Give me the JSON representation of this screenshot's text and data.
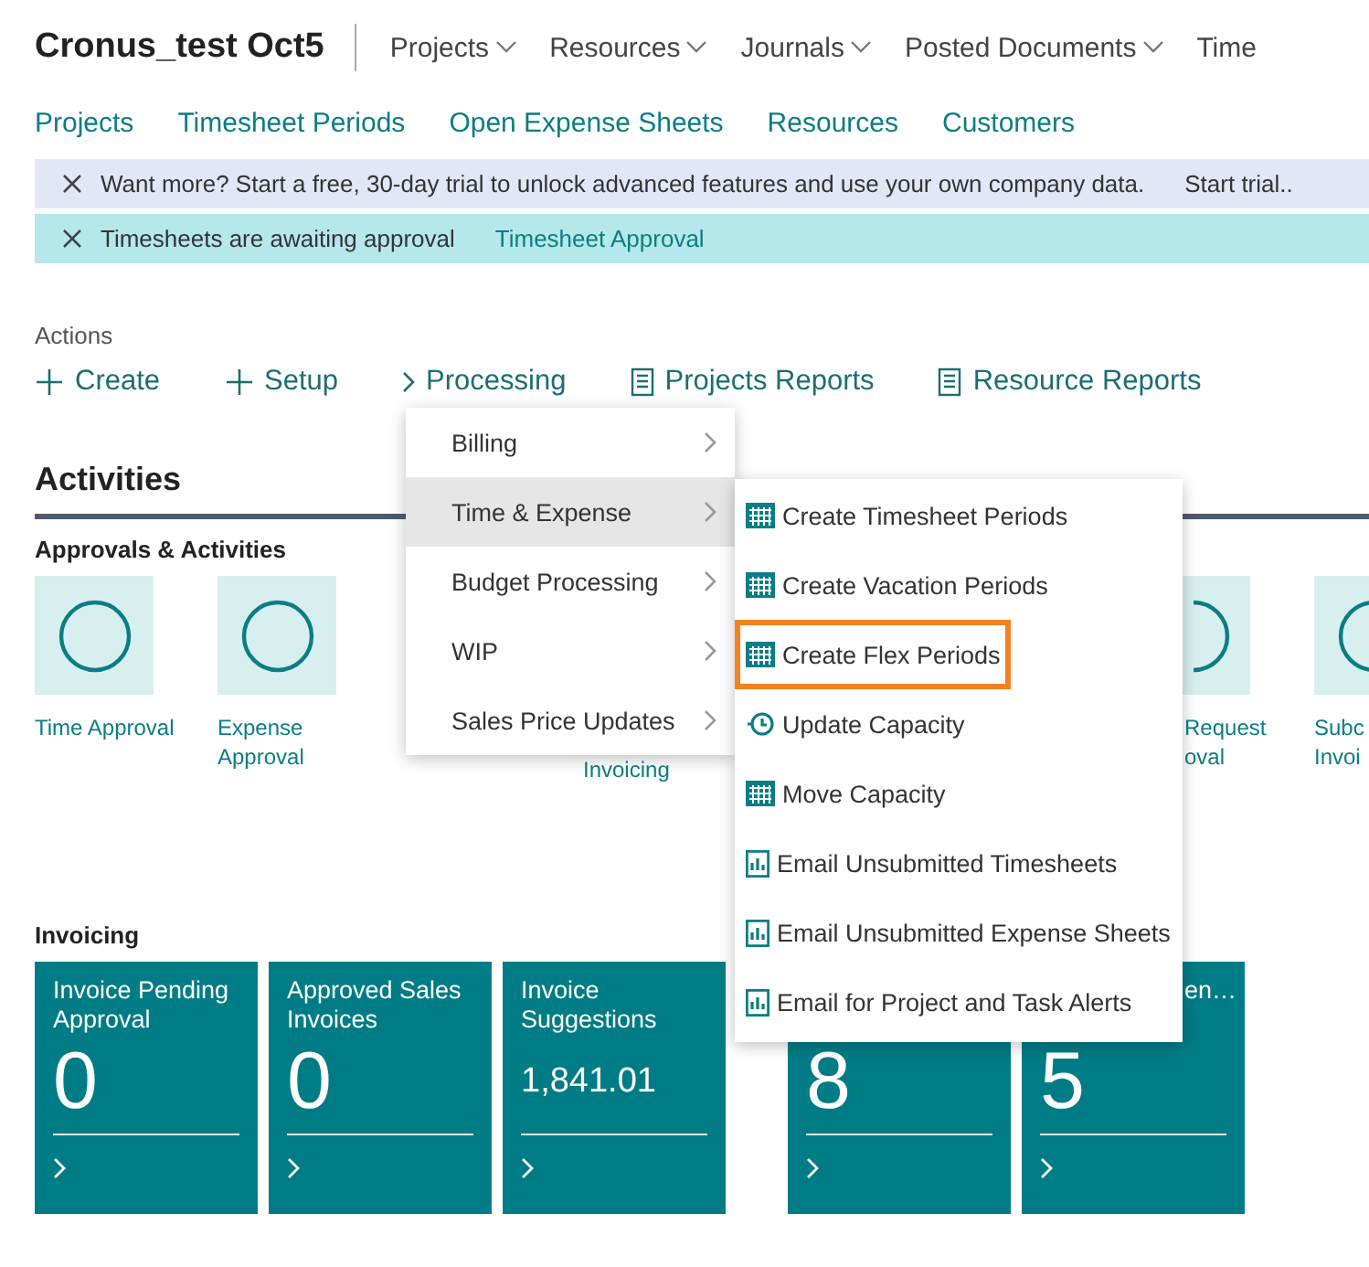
{
  "header": {
    "company": "Cronus_test Oct5",
    "nav": [
      {
        "label": "Projects",
        "dropdown": true
      },
      {
        "label": "Resources",
        "dropdown": true
      },
      {
        "label": "Journals",
        "dropdown": true
      },
      {
        "label": "Posted Documents",
        "dropdown": true
      },
      {
        "label": "Time",
        "dropdown": false
      }
    ]
  },
  "links": [
    "Projects",
    "Timesheet Periods",
    "Open Expense Sheets",
    "Resources",
    "Customers"
  ],
  "banners": [
    {
      "kind": "trial",
      "message": "Want more? Start a free, 30-day trial to unlock advanced features and use your own company data.",
      "action": "Start trial.."
    },
    {
      "kind": "approval",
      "message": "Timesheets are awaiting approval",
      "action": "Timesheet Approval"
    }
  ],
  "actions": {
    "label": "Actions",
    "items": [
      {
        "label": "Create",
        "kind": "add"
      },
      {
        "label": "Setup",
        "kind": "add"
      },
      {
        "label": "Processing",
        "kind": "group"
      },
      {
        "label": "Projects Reports",
        "kind": "report"
      },
      {
        "label": "Resource Reports",
        "kind": "report"
      }
    ]
  },
  "activities": {
    "title": "Activities",
    "approvals": {
      "title": "Approvals & Activities",
      "tiles": [
        {
          "label": [
            "Time Approval"
          ],
          "kind": "tile"
        },
        {
          "label": [
            "Expense",
            "Approval"
          ],
          "kind": "tile"
        },
        {
          "label": [
            "Invoicing"
          ],
          "kind": "lower-label"
        },
        {
          "label": [
            "Request",
            "oval"
          ],
          "kind": "partial"
        },
        {
          "label": [
            "Subc",
            "Invoi"
          ],
          "kind": "tile"
        }
      ]
    },
    "invoicing": {
      "title": "Invoicing",
      "tiles": [
        {
          "title": "Invoice Pending Approval",
          "value": "0",
          "kind": "count"
        },
        {
          "title": "Approved Sales Invoices",
          "value": "0",
          "kind": "count"
        },
        {
          "title": "Invoice Suggestions",
          "value": "1,841.01",
          "kind": "amount"
        },
        {
          "value": "8",
          "kind": "covered"
        },
        {
          "title": "en…",
          "value": "5",
          "kind": "partial"
        }
      ]
    }
  },
  "processing_menu": [
    {
      "label": "Billing",
      "selected": false
    },
    {
      "label": "Time & Expense",
      "selected": true
    },
    {
      "label": "Budget Processing",
      "selected": false
    },
    {
      "label": "WIP",
      "selected": false
    },
    {
      "label": "Sales Price Updates",
      "selected": false
    }
  ],
  "submenu": [
    {
      "label": "Create Timesheet Periods",
      "kind": "calendar",
      "highlighted": false
    },
    {
      "label": "Create Vacation Periods",
      "kind": "calendar",
      "highlighted": false
    },
    {
      "label": "Create Flex Periods",
      "kind": "calendar",
      "highlighted": true
    },
    {
      "label": "Update Capacity",
      "kind": "update",
      "highlighted": false
    },
    {
      "label": "Move Capacity",
      "kind": "calendar",
      "highlighted": false
    },
    {
      "label": "Email Unsubmitted Timesheets",
      "kind": "report",
      "highlighted": false
    },
    {
      "label": "Email Unsubmitted Expense Sheets",
      "kind": "report",
      "highlighted": false
    },
    {
      "label": "Email for Project and Task Alerts",
      "kind": "report",
      "highlighted": false
    }
  ]
}
